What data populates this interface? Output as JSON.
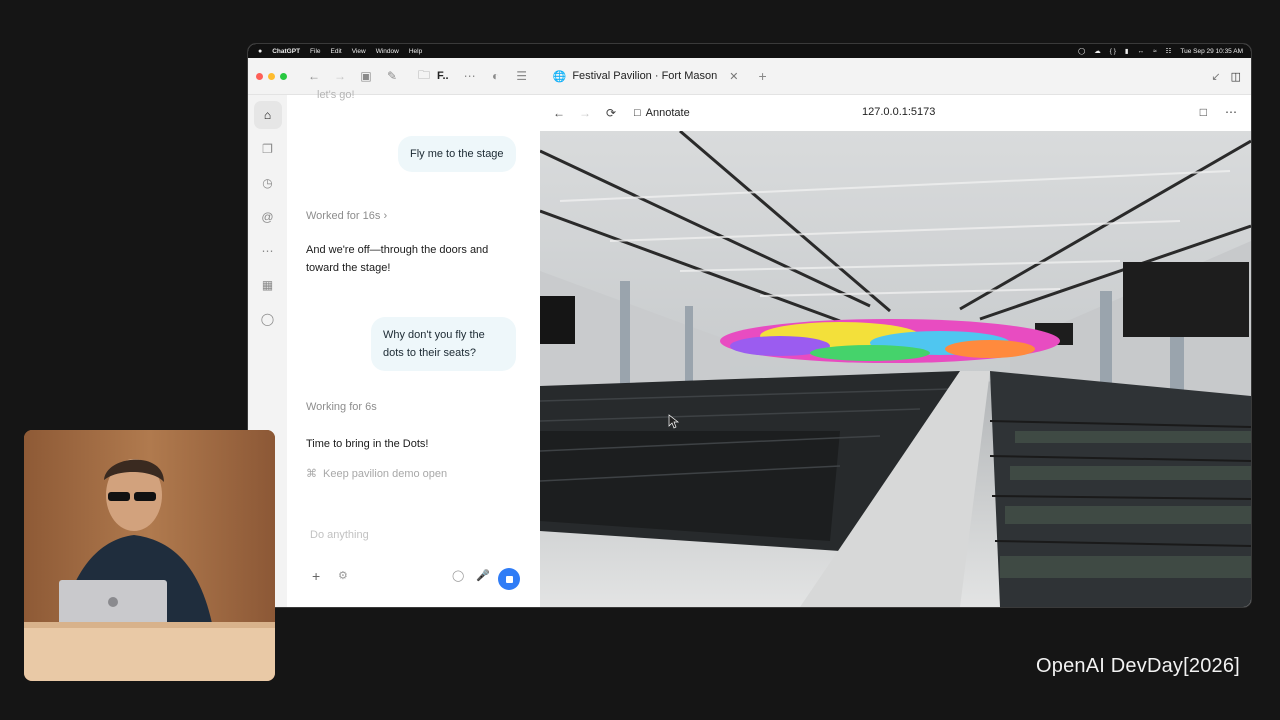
{
  "menubar": {
    "app": "ChatGPT",
    "items": [
      "File",
      "Edit",
      "View",
      "Window",
      "Help"
    ],
    "clock": "Tue Sep 29  10:35 AM"
  },
  "toolbar": {
    "folder_label": "F..",
    "tab_title": "Festival Pavilion · Fort Mason"
  },
  "chat": {
    "cut_text": "let's go!",
    "messages": {
      "user1": "Fly me to the stage",
      "worked": "Worked for 16s",
      "assistant1": "And we're off—through the doors and toward the stage!",
      "user2": "Why don't you fly the dots to their seats?",
      "working": "Working for 6s",
      "assistant2": "Time to bring in the Dots!",
      "task": "Keep pavilion demo open"
    },
    "composer_placeholder": "Do anything"
  },
  "browser": {
    "annotate_label": "Annotate",
    "url": "127.0.0.1:5173"
  },
  "footer": {
    "brand": "OpenAI DevDay",
    "year": "[2026]"
  }
}
